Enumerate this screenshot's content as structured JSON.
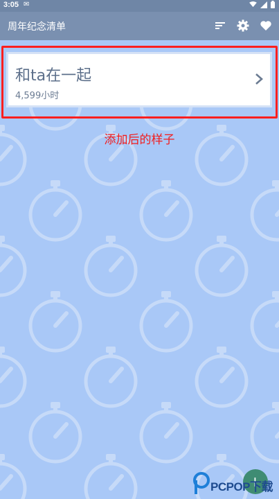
{
  "status": {
    "time": "3:05"
  },
  "appbar": {
    "title": "周年纪念清单"
  },
  "card": {
    "name": "和ta在一起",
    "hours": "4,599小时"
  },
  "caption": "添加后的样子",
  "fab": {
    "label": "+"
  },
  "watermark": {
    "brand": "PCPOP下载"
  },
  "icons": {
    "sort": "sort-icon",
    "settings": "gear-icon",
    "favorite": "heart-icon",
    "chevron": "chevron-right-icon",
    "background": "stopwatch-icon"
  },
  "colors": {
    "statusbar": "#6f86a6",
    "appbar": "#7a90b0",
    "background": "#a9c8f7",
    "highlight": "#ff1f1f",
    "fab": "#3f8c73"
  }
}
